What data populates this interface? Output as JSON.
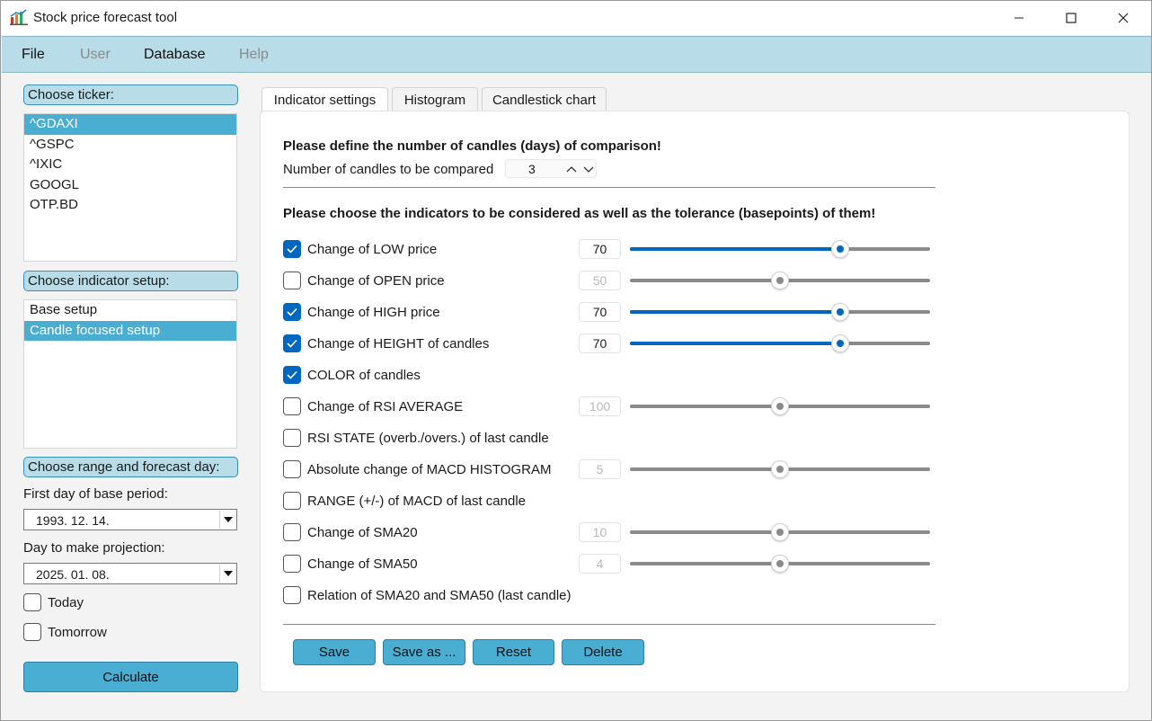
{
  "window": {
    "title": "Stock price forecast tool"
  },
  "menu": {
    "items": [
      {
        "label": "File",
        "enabled": true
      },
      {
        "label": "User",
        "enabled": false
      },
      {
        "label": "Database",
        "enabled": true
      },
      {
        "label": "Help",
        "enabled": false
      }
    ]
  },
  "left": {
    "ticker_header": "Choose ticker:",
    "tickers": [
      "^GDAXI",
      "^GSPC",
      "^IXIC",
      "GOOGL",
      "OTP.BD"
    ],
    "selected_ticker": "^GDAXI",
    "setup_header": "Choose indicator setup:",
    "setups": [
      "Base setup",
      "Candle focused setup"
    ],
    "selected_setup": "Candle focused setup",
    "range_header": "Choose range and forecast day:",
    "first_day_label": "First day of base period:",
    "first_day_value": "1993. 12. 14.",
    "projection_label": "Day to make projection:",
    "projection_value": "2025. 01. 08.",
    "today_label": "Today",
    "today_checked": false,
    "tomorrow_label": "Tomorrow",
    "tomorrow_checked": false,
    "calculate_label": "Calculate"
  },
  "tabs": [
    {
      "label": "Indicator settings",
      "active": true
    },
    {
      "label": "Histogram",
      "active": false
    },
    {
      "label": "Candlestick chart",
      "active": false
    }
  ],
  "settings": {
    "candles_heading": "Please define the number of candles (days) of comparison!",
    "candles_label": "Number of candles to be compared",
    "candles_value": "3",
    "indicators_heading": "Please choose the indicators to be considered as well as the tolerance (basepoints) of them!",
    "indicators": [
      {
        "label": "Change of LOW price",
        "checked": true,
        "tolerance": "70",
        "slider_fraction": 0.7
      },
      {
        "label": "Change of OPEN price",
        "checked": false,
        "tolerance": "50",
        "slider_fraction": 0.5
      },
      {
        "label": "Change of HIGH price",
        "checked": true,
        "tolerance": "70",
        "slider_fraction": 0.7
      },
      {
        "label": "Change of HEIGHT of candles",
        "checked": true,
        "tolerance": "70",
        "slider_fraction": 0.7
      },
      {
        "label": "COLOR of candles",
        "checked": true
      },
      {
        "label": "Change of RSI AVERAGE",
        "checked": false,
        "tolerance": "100",
        "slider_fraction": 0.5
      },
      {
        "label": "RSI STATE (overb./overs.) of last candle",
        "checked": false
      },
      {
        "label": "Absolute change of MACD HISTOGRAM",
        "checked": false,
        "tolerance": "5",
        "slider_fraction": 0.5
      },
      {
        "label": "RANGE (+/-) of MACD of last candle",
        "checked": false
      },
      {
        "label": "Change of SMA20",
        "checked": false,
        "tolerance": "10",
        "slider_fraction": 0.5
      },
      {
        "label": "Change of SMA50",
        "checked": false,
        "tolerance": "4",
        "slider_fraction": 0.5
      },
      {
        "label": "Relation of SMA20 and SMA50 (last candle)",
        "checked": false
      }
    ],
    "buttons": {
      "save": "Save",
      "save_as": "Save as ...",
      "reset": "Reset",
      "delete": "Delete"
    }
  },
  "colors": {
    "accent_blue": "#0067c0",
    "header_blue": "#b8dde8",
    "button_blue": "#4aaed3"
  }
}
